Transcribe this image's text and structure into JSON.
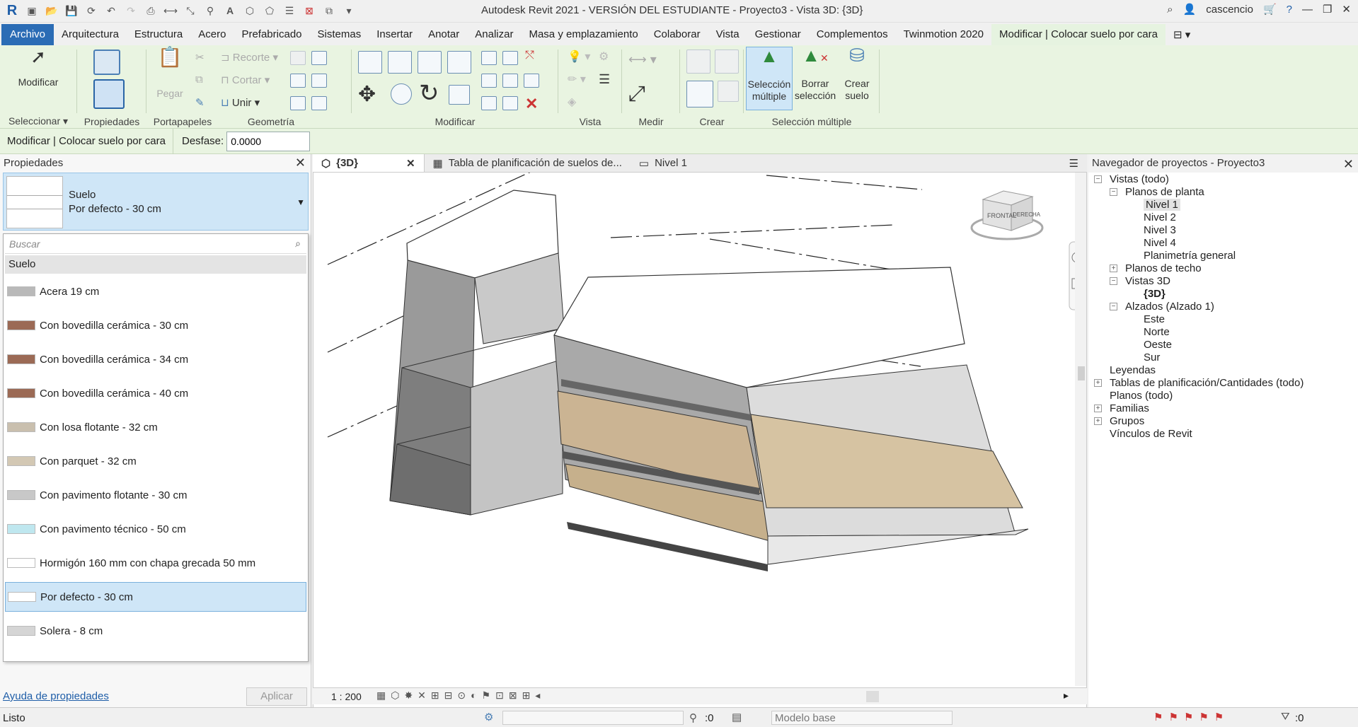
{
  "window": {
    "title": "Autodesk Revit 2021 - VERSIÓN DEL ESTUDIANTE - Proyecto3 - Vista 3D: {3D}",
    "user": "cascencio"
  },
  "menu": [
    "Archivo",
    "Arquitectura",
    "Estructura",
    "Acero",
    "Prefabricado",
    "Sistemas",
    "Insertar",
    "Anotar",
    "Analizar",
    "Masa y emplazamiento",
    "Colaborar",
    "Vista",
    "Gestionar",
    "Complementos",
    "Twinmotion 2020",
    "Modificar | Colocar suelo por cara"
  ],
  "ribbon": {
    "modify_label": "Modificar",
    "paste_label": "Pegar",
    "cut_label": "Cortar",
    "cope_label": "Recorte",
    "join_label": "Unir",
    "panels": [
      "Seleccionar",
      "Propiedades",
      "Portapapeles",
      "Geometría",
      "Modificar",
      "Vista",
      "Medir",
      "Crear",
      "Selección múltiple"
    ],
    "select_multiple": "Selección múltiple",
    "clear_selection": "Borrar selección",
    "create_floor": "Crear suelo"
  },
  "options_bar": {
    "context": "Modificar | Colocar suelo por cara",
    "offset_label": "Desfase:",
    "offset_value": "0.0000"
  },
  "properties": {
    "title": "Propiedades",
    "family": "Suelo",
    "type": "Por defecto - 30 cm",
    "search_placeholder": "Buscar",
    "category": "Suelo",
    "types": [
      {
        "name": "Acera 19 cm",
        "color": "#b9b9b9"
      },
      {
        "name": "Con bovedilla cerámica - 30 cm",
        "color": "#9b6a55"
      },
      {
        "name": "Con bovedilla cerámica - 34 cm",
        "color": "#9b6a55"
      },
      {
        "name": "Con bovedilla cerámica - 40 cm",
        "color": "#9b6a55"
      },
      {
        "name": "Con losa flotante - 32 cm",
        "color": "#c9bfae"
      },
      {
        "name": "Con parquet - 32 cm",
        "color": "#d3c8b4"
      },
      {
        "name": "Con pavimento flotante - 30 cm",
        "color": "#c8c8c8"
      },
      {
        "name": "Con pavimento técnico - 50 cm",
        "color": "#bfe7ef"
      },
      {
        "name": "Hormigón 160 mm con chapa grecada 50 mm",
        "color": "#ffffff"
      },
      {
        "name": "Por defecto - 30 cm",
        "color": "#ffffff"
      },
      {
        "name": "Solera - 8 cm",
        "color": "#d5d5d5"
      }
    ],
    "help_link": "Ayuda de propiedades",
    "apply_label": "Aplicar"
  },
  "view_tabs": [
    {
      "label": "{3D}",
      "active": true
    },
    {
      "label": "Tabla de planificación de suelos de...",
      "active": false
    },
    {
      "label": "Nivel 1",
      "active": false
    }
  ],
  "view": {
    "scale": "1 : 200",
    "viewcube_front": "FRONTAL",
    "viewcube_right": "DERECHA"
  },
  "navigator": {
    "title": "Navegador de proyectos - Proyecto3",
    "nodes": [
      {
        "label": "Vistas (todo)"
      },
      {
        "label": "Planos de planta"
      },
      {
        "label": "Nivel 1"
      },
      {
        "label": "Nivel 2"
      },
      {
        "label": "Nivel 3"
      },
      {
        "label": "Nivel 4"
      },
      {
        "label": "Planimetría general"
      },
      {
        "label": "Planos de techo"
      },
      {
        "label": "Vistas 3D"
      },
      {
        "label": "{3D}"
      },
      {
        "label": "Alzados (Alzado 1)"
      },
      {
        "label": "Este"
      },
      {
        "label": "Norte"
      },
      {
        "label": "Oeste"
      },
      {
        "label": "Sur"
      },
      {
        "label": "Leyendas"
      },
      {
        "label": "Tablas de planificación/Cantidades (todo)"
      },
      {
        "label": "Planos (todo)"
      },
      {
        "label": "Familias"
      },
      {
        "label": "Grupos"
      },
      {
        "label": "Vínculos de Revit"
      }
    ]
  },
  "status": {
    "text": "Listo",
    "sel_count": ":0",
    "model": "Modelo base",
    "filter_count": ":0"
  }
}
